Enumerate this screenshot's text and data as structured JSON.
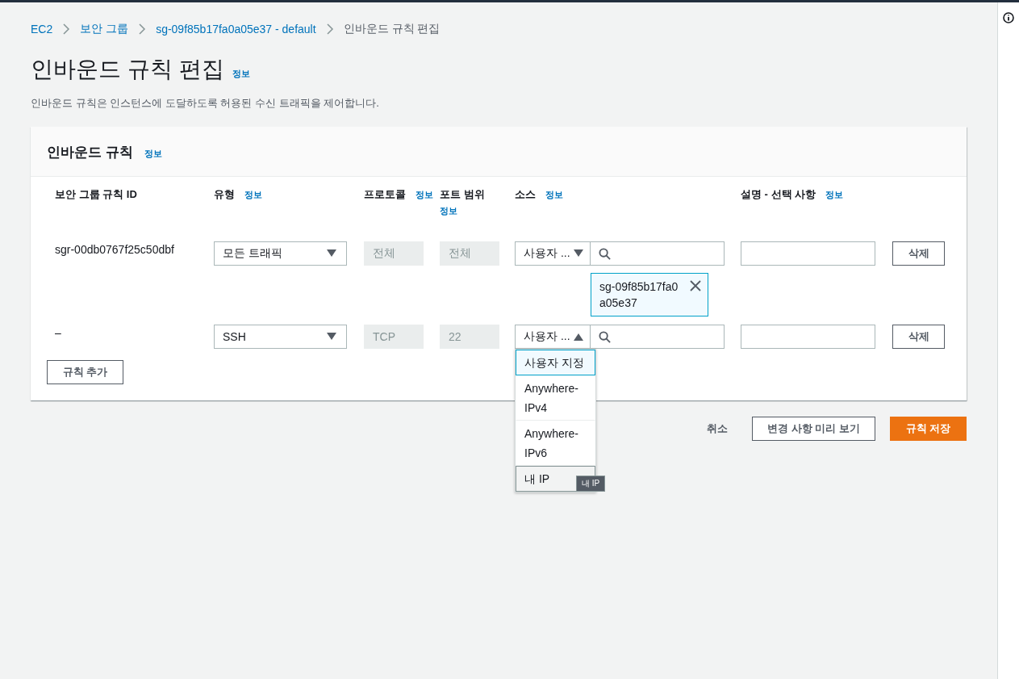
{
  "breadcrumbs": [
    {
      "label": "EC2",
      "kind": "link"
    },
    {
      "label": "보안 그룹",
      "kind": "link"
    },
    {
      "label": "sg-09f85b17fa0a05e37 - default",
      "kind": "link"
    },
    {
      "label": "인바운드 규칙 편집",
      "kind": "current"
    }
  ],
  "title": "인바운드 규칙 편집",
  "title_info": "정보",
  "description": "인바운드 규칙은 인스턴스에 도달하도록 허용된 수신 트래픽을 제어합니다.",
  "panel": {
    "title": "인바운드 규칙",
    "title_info": "정보",
    "columns": [
      {
        "label": "보안 그룹 규칙 ID"
      },
      {
        "label": "유형",
        "info": "정보"
      },
      {
        "label": "프로토콜",
        "info": "정보"
      },
      {
        "label": "포트 범위",
        "info": "정보"
      },
      {
        "label": "소스",
        "info": "정보"
      },
      {
        "label": "설명 - 선택 사항",
        "info": "정보"
      }
    ],
    "rows": [
      {
        "id": "sgr-00db0767f25c50dbf",
        "type": "모든 트래픽",
        "protocol": "전체",
        "port": "전체",
        "source": {
          "value": "사용자 ...",
          "expanded": false,
          "chips": [
            "sg-09f85b17fa0a05e37"
          ]
        },
        "delete": "삭제"
      },
      {
        "id": "–",
        "type": "SSH",
        "protocol": "TCP",
        "port": "22",
        "source": {
          "value": "사용자 ...",
          "expanded": true,
          "options": [
            {
              "label": "사용자 지정",
              "selected": true,
              "hovered": false
            },
            {
              "label": "Anywhere-IPv4",
              "selected": false,
              "hovered": false
            },
            {
              "label": "Anywhere-IPv6",
              "selected": false,
              "hovered": false
            },
            {
              "label": "내 IP",
              "selected": false,
              "hovered": true
            }
          ],
          "tooltip": "내 IP"
        },
        "delete": "삭제"
      }
    ],
    "add_button": "규칙 추가"
  },
  "footer": {
    "cancel": "취소",
    "preview": "변경 사항 미리 보기",
    "save": "규칙 저장"
  }
}
